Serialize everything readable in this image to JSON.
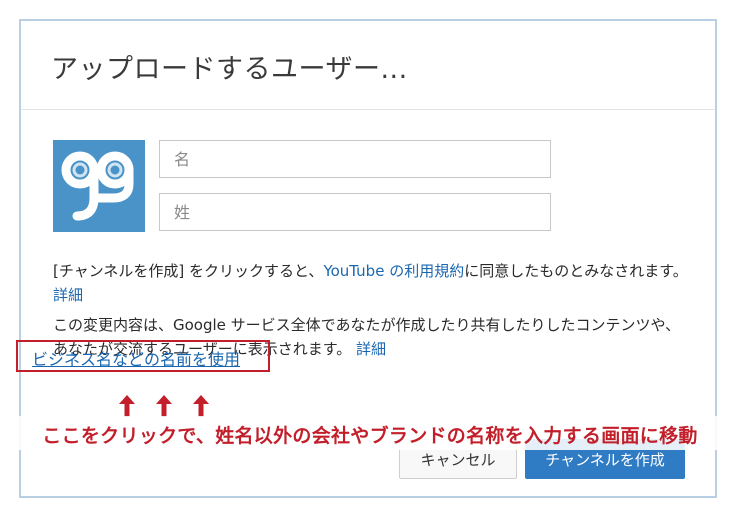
{
  "dialog": {
    "title": "アップロードするユーザー..."
  },
  "form": {
    "first_name_placeholder": "名",
    "last_name_placeholder": "姓"
  },
  "terms": {
    "text_before": "[チャンネルを作成] をクリックすると、",
    "tos_link": "YouTube の利用規約",
    "text_after": "に同意したものとみなされます。",
    "details_link": "詳細"
  },
  "notice": {
    "text": "この変更内容は、Google サービス全体であなたが作成したり共有したりしたコンテンツや、あなたが交流するユーザーに表示されます。",
    "details_link": "詳細"
  },
  "business_link": "ビジネス名などの名前を使用",
  "buttons": {
    "cancel": "キャンセル",
    "create": "チャンネルを作成"
  },
  "annotation": {
    "text": "ここをクリックで、姓名以外の会社やブランドの名称を入力する画面に移動",
    "color": "#c21f2a"
  },
  "colors": {
    "link": "#1a67b0",
    "primary_button": "#2f7cc4",
    "logo_background": "#4a93c8"
  }
}
